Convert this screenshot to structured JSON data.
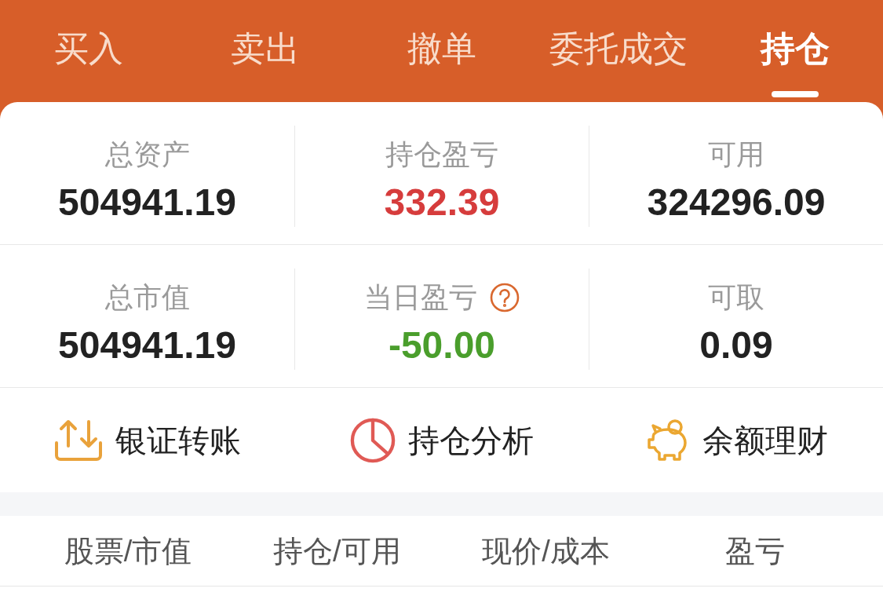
{
  "tabs": [
    {
      "label": "买入",
      "selected": false
    },
    {
      "label": "卖出",
      "selected": false
    },
    {
      "label": "撤单",
      "selected": false
    },
    {
      "label": "委托成交",
      "selected": false
    },
    {
      "label": "持仓",
      "selected": true
    }
  ],
  "summary": [
    [
      {
        "label": "总资产",
        "value": "504941.19",
        "color": "#222222",
        "help": false
      },
      {
        "label": "持仓盈亏",
        "value": "332.39",
        "color": "#d63c3c",
        "help": false
      },
      {
        "label": "可用",
        "value": "324296.09",
        "color": "#222222",
        "help": false
      }
    ],
    [
      {
        "label": "总市值",
        "value": "504941.19",
        "color": "#222222",
        "help": false
      },
      {
        "label": "当日盈亏",
        "value": "-50.00",
        "color": "#4a9e2c",
        "help": true
      },
      {
        "label": "可取",
        "value": "0.09",
        "color": "#222222",
        "help": false
      }
    ]
  ],
  "actions": [
    {
      "label": "银证转账",
      "kind": "transfer"
    },
    {
      "label": "持仓分析",
      "kind": "analysis"
    },
    {
      "label": "余额理财",
      "kind": "savings"
    }
  ],
  "table": {
    "columns": [
      "股票/市值",
      "持仓/可用",
      "现价/成本",
      "盈亏"
    ]
  }
}
